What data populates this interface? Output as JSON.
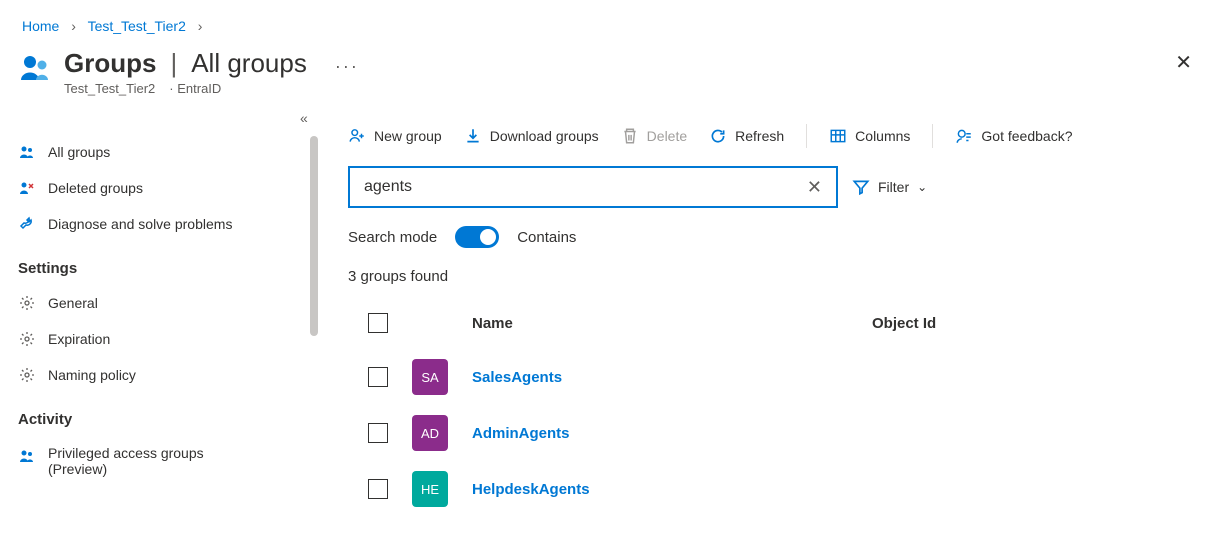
{
  "breadcrumb": {
    "home": "Home",
    "tenant": "Test_Test_Tier2"
  },
  "header": {
    "title_main": "Groups",
    "title_sub": "All groups",
    "subtitle1": "Test_Test_Tier2",
    "subtitle2": "EntraID"
  },
  "sidebar": {
    "all_groups": "All groups",
    "deleted_groups": "Deleted groups",
    "diagnose": "Diagnose and solve problems",
    "settings_header": "Settings",
    "general": "General",
    "expiration": "Expiration",
    "naming": "Naming policy",
    "activity_header": "Activity",
    "privileged": "Privileged access groups (Preview)"
  },
  "toolbar": {
    "new_group": "New group",
    "download": "Download groups",
    "delete": "Delete",
    "refresh": "Refresh",
    "columns": "Columns",
    "feedback": "Got feedback?"
  },
  "search": {
    "value": "agents",
    "filter_label": "Filter",
    "mode_label": "Search mode",
    "mode_value": "Contains"
  },
  "results": {
    "count_text": "3 groups found",
    "col_name": "Name",
    "col_objid": "Object Id",
    "rows": [
      {
        "initials": "SA",
        "name": "SalesAgents",
        "color": "#8b2c8b"
      },
      {
        "initials": "AD",
        "name": "AdminAgents",
        "color": "#8b2c8b"
      },
      {
        "initials": "HE",
        "name": "HelpdeskAgents",
        "color": "#00a99d"
      }
    ]
  }
}
